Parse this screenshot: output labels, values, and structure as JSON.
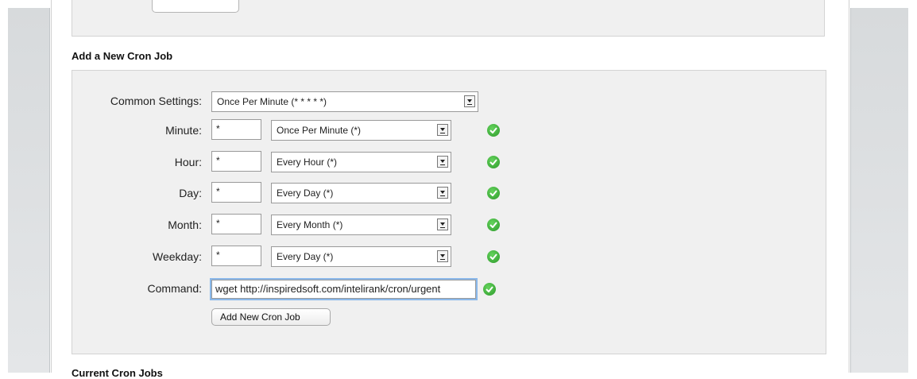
{
  "section_title": "Add a New Cron Job",
  "common_settings": {
    "label": "Common Settings:",
    "selected": "Once Per Minute (* * * * *)"
  },
  "fields": [
    {
      "label": "Minute:",
      "value": "*",
      "select": "Once Per Minute (*)",
      "valid": true
    },
    {
      "label": "Hour:",
      "value": "*",
      "select": "Every Hour (*)",
      "valid": true
    },
    {
      "label": "Day:",
      "value": "*",
      "select": "Every Day (*)",
      "valid": true
    },
    {
      "label": "Month:",
      "value": "*",
      "select": "Every Month (*)",
      "valid": true
    },
    {
      "label": "Weekday:",
      "value": "*",
      "select": "Every Day (*)",
      "valid": true
    }
  ],
  "command": {
    "label": "Command:",
    "value": "wget http://inspiredsoft.com/intelirank/cron/urgent"
  },
  "submit_label": "Add New Cron Job",
  "next_section_title": "Current Cron Jobs",
  "colors": {
    "accent": "#2e9a2c",
    "focus": "#8ab8ea",
    "panel": "#f0f0f0"
  },
  "icons": {
    "valid": "green-check-icon",
    "dropdown": "dropdown-arrow-icon"
  }
}
